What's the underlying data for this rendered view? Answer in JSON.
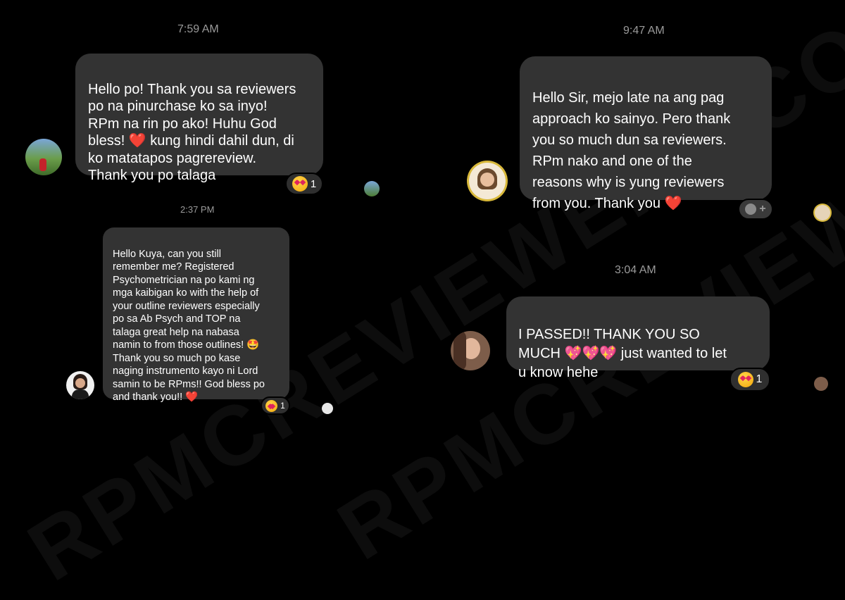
{
  "watermark": "RPMCREVIEWERS.COM",
  "timestamps": {
    "t1": "7:59 AM",
    "t2": "2:37 PM",
    "t3": "9:47 AM",
    "t4": "3:04 AM"
  },
  "messages": [
    {
      "text": "Hello po! Thank you sa reviewers\npo na pinurchase ko sa inyo!\nRPm na rin po ako! Huhu God\nbless! ❤️ kung hindi dahil dun, di\nko matatapos pagrereview.\nThank you po talaga",
      "reaction_count": "1"
    },
    {
      "text": "Hello Kuya, can you still\nremember me? Registered\nPsychometrician na po kami ng\nmga kaibigan ko with the help of\nyour outline reviewers especially\npo sa Ab Psych and TOP na\ntalaga great help na nabasa\nnamin to from those outlines! 🤩\nThank you so much po kase\nnaging instrumento kayo ni Lord\nsamin to be RPms!! God bless po\nand thank you!! ❤️",
      "reaction_count": "1"
    },
    {
      "text": "Hello Sir, mejo late na ang pag\napproach ko sainyo. Pero thank\nyou so much dun sa reviewers.\nRPm nako and one of the\nreasons why is yung reviewers\nfrom you. Thank you ❤️",
      "reaction_label": "+"
    },
    {
      "text": "I PASSED!! THANK YOU SO\nMUCH 💖💖💖 just wanted to let\nu know hehe",
      "reaction_count": "1"
    }
  ]
}
